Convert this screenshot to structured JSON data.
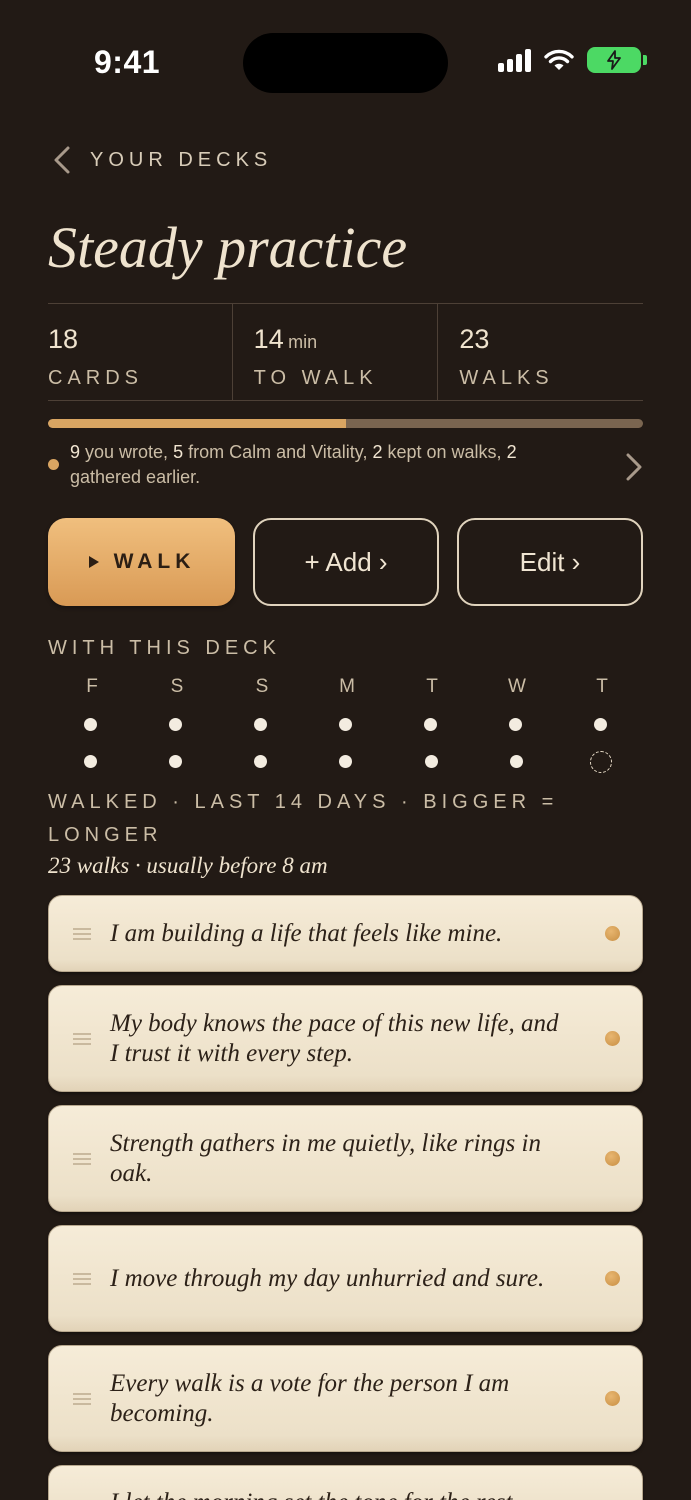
{
  "status_bar": {
    "time": "9:41"
  },
  "header": {
    "back_label": "YOUR DECKS",
    "title": "Steady practice"
  },
  "stats": [
    {
      "value": "18",
      "unit": "",
      "label": "CARDS"
    },
    {
      "value": "14",
      "unit": "min",
      "label": "TO WALK"
    },
    {
      "value": "23",
      "unit": "",
      "label": "WALKS"
    }
  ],
  "progress": {
    "fraction": 0.5
  },
  "composition": {
    "n_wrote": "9",
    "t_wrote": " you wrote, ",
    "n_from": "5",
    "t_from": " from Calm and Vitality, ",
    "n_kept": "2",
    "t_kept": " kept on walks, ",
    "n_gathered": "2",
    "t_gathered": " gathered earlier."
  },
  "actions": {
    "walk": "WALK",
    "add": "+ Add ›",
    "edit": "Edit ›"
  },
  "with_deck": {
    "label": "WITH THIS DECK",
    "days": [
      "F",
      "S",
      "S",
      "M",
      "T",
      "W",
      "T"
    ],
    "note": "WALKED · LAST 14 DAYS · BIGGER = LONGER",
    "summary": "23 walks · usually before 8 am"
  },
  "cards": [
    "I am building a life that feels like mine.",
    "My body knows the pace of this new life, and I trust it with every step.",
    "Strength gathers in me quietly, like rings in oak.",
    "I move through my day unhurried and sure.",
    "Every walk is a vote for the person I am becoming.",
    "I let the morning set the tone for the rest."
  ],
  "colors": {
    "background": "#221a15",
    "accent": "#d9a562",
    "card": "#f6ecd8",
    "battery": "#4cd964"
  }
}
